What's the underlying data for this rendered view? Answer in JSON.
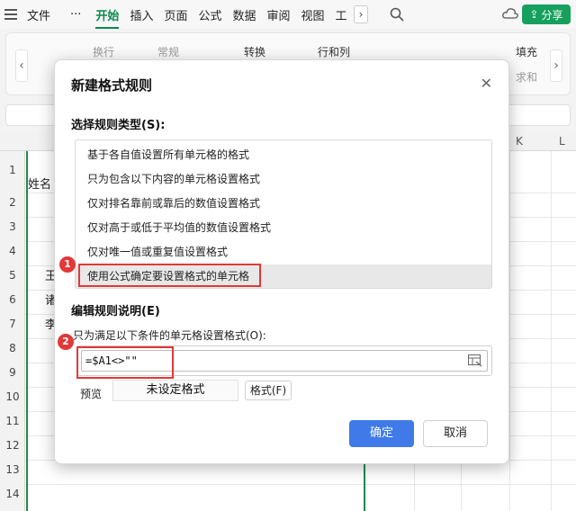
{
  "menubar": {
    "file": "文件",
    "more": "···",
    "tabs": [
      "开始",
      "插入",
      "页面",
      "公式",
      "数据",
      "审阅",
      "视图",
      "工"
    ],
    "active_tab": "开始",
    "share": "分享"
  },
  "ribbon": {
    "wrap_text": "换行",
    "number_format": "常规",
    "convert": "转换",
    "rows_cols": "行和列",
    "fill": "填充",
    "sum": "求和"
  },
  "sheet": {
    "col_headers": [
      "K",
      "L"
    ],
    "row_numbers": [
      "1",
      "2",
      "3",
      "4",
      "5",
      "6",
      "7",
      "8",
      "9",
      "10",
      "11",
      "12",
      "13",
      "14"
    ],
    "cells": {
      "a1": "姓名",
      "a5": "王",
      "a6": "诸",
      "a7": "李"
    }
  },
  "dialog": {
    "title": "新建格式规则",
    "rule_type_label": "选择规则类型(S):",
    "rule_types": [
      "基于各自值设置所有单元格的格式",
      "只为包含以下内容的单元格设置格式",
      "仅对排名靠前或靠后的数值设置格式",
      "仅对高于或低于平均值的数值设置格式",
      "仅对唯一值或重复值设置格式",
      "使用公式确定要设置格式的单元格"
    ],
    "selected_rule_index": 5,
    "edit_label": "编辑规则说明(E)",
    "condition_label": "只为满足以下条件的单元格设置格式(O):",
    "formula": "=$A1<>\"\"",
    "preview_label": "预览",
    "preview_text": "未设定格式",
    "format_button": "格式(F)",
    "ok": "确定",
    "cancel": "取消"
  },
  "annotations": [
    "1",
    "2"
  ],
  "colors": {
    "accent_green": "#0b8a4b",
    "primary_blue": "#3f7ae8",
    "annotation_red": "#e23838"
  }
}
